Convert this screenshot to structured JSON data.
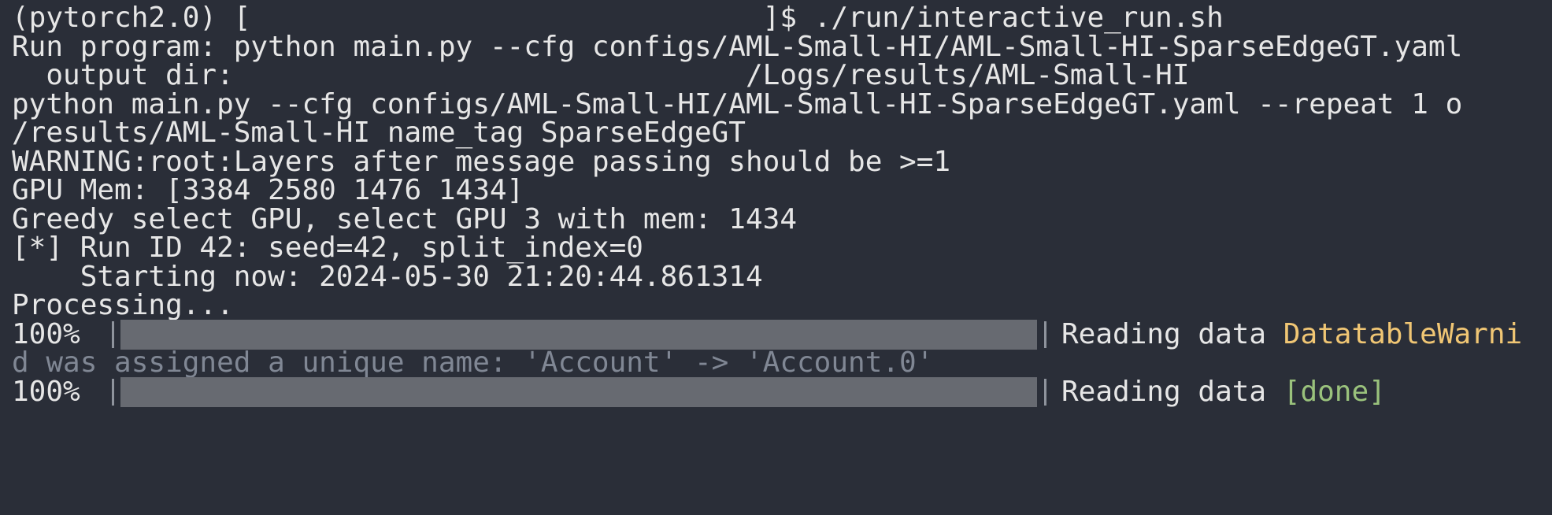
{
  "terminal": {
    "lines": [
      "(pytorch2.0) [                              ]$ ./run/interactive_run.sh",
      "Run program: python main.py --cfg configs/AML-Small-HI/AML-Small-HI-SparseEdgeGT.yaml",
      "  output dir:                              /Logs/results/AML-Small-HI",
      "python main.py --cfg configs/AML-Small-HI/AML-Small-HI-SparseEdgeGT.yaml --repeat 1 o",
      "/results/AML-Small-HI name_tag SparseEdgeGT",
      "WARNING:root:Layers after message passing should be >=1",
      "GPU Mem: [3384 2580 1476 1434]",
      "Greedy select GPU, select GPU 3 with mem: 1434",
      "[*] Run ID 42: seed=42, split_index=0",
      "    Starting now: 2024-05-30 21:20:44.861314",
      "Processing..."
    ],
    "progress1": {
      "percent_label": "100%",
      "fraction": 1.0,
      "message": "Reading data ",
      "warning": "DatatableWarni"
    },
    "wrapped_warning": "d was assigned a unique name: 'Account' -> 'Account.0'",
    "progress2": {
      "percent_label": "100%",
      "fraction": 1.0,
      "message": "Reading data ",
      "status": "[done]"
    }
  },
  "colors": {
    "background": "#2a2e38",
    "text": "#e6e6e6",
    "warning": "#f0c674",
    "done": "#9ac27c",
    "muted": "#808794",
    "progress_bar": "#676a71"
  }
}
